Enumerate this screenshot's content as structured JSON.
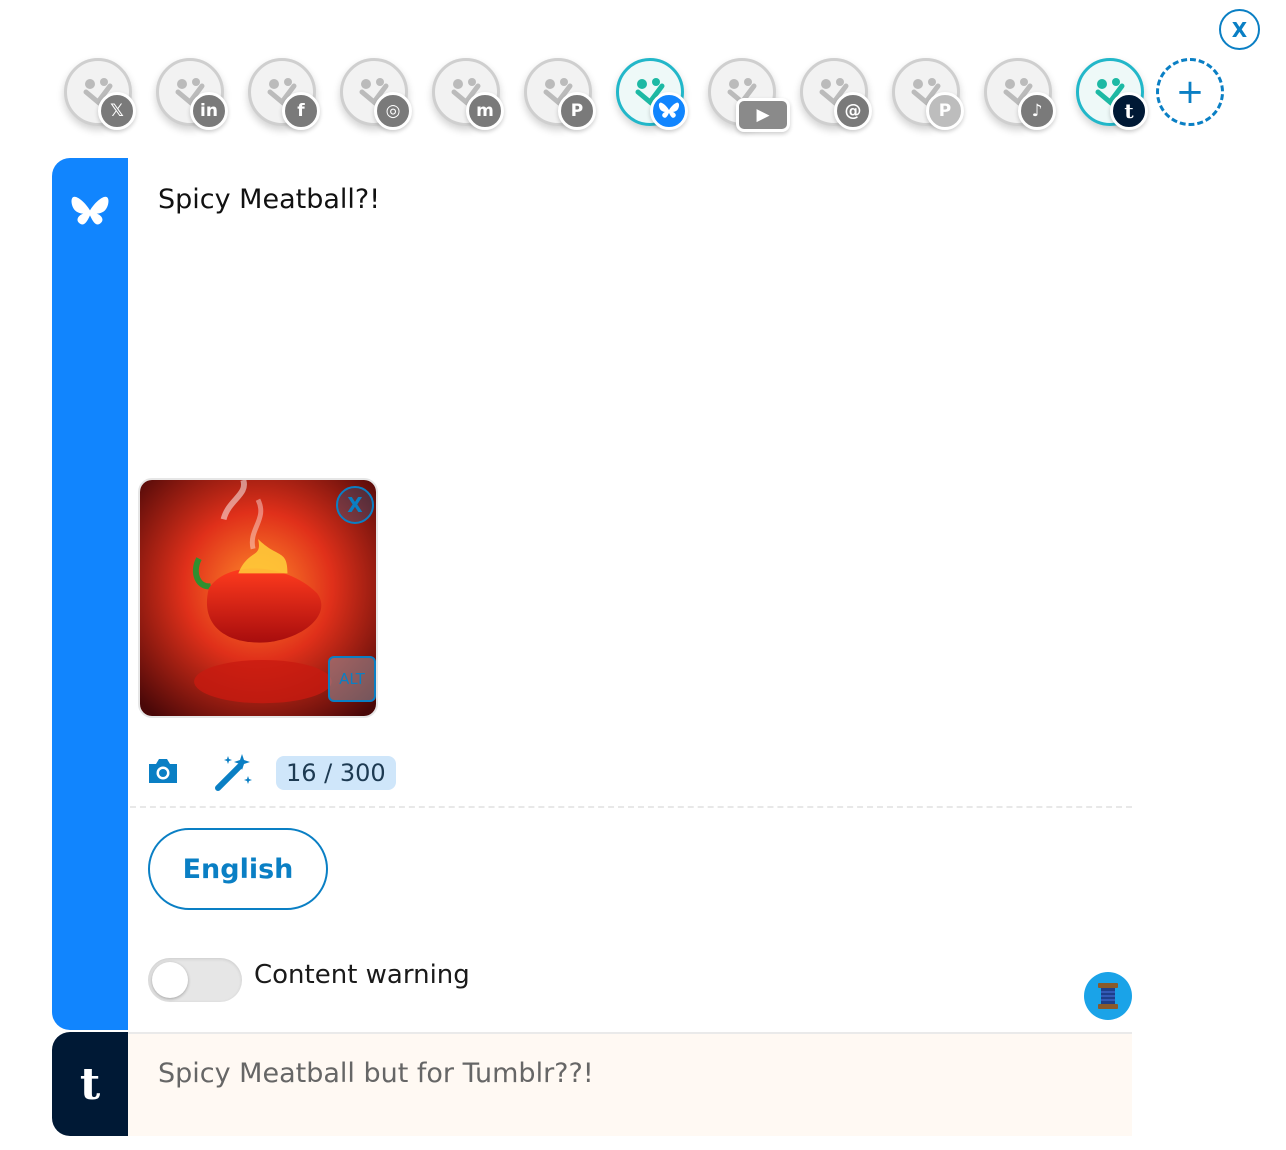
{
  "dialog": {
    "close_label": "X"
  },
  "accounts": [
    {
      "network": "X",
      "badge": "𝕏",
      "active": false
    },
    {
      "network": "LinkedIn",
      "badge": "in",
      "active": false
    },
    {
      "network": "Facebook",
      "badge": "f",
      "active": false
    },
    {
      "network": "Instagram",
      "badge": "◎",
      "active": false
    },
    {
      "network": "Mastodon",
      "badge": "m",
      "active": false
    },
    {
      "network": "Pinterest",
      "badge": "P",
      "active": false
    },
    {
      "network": "Bluesky",
      "badge": "",
      "active": true
    },
    {
      "network": "YouTube",
      "badge": "▶",
      "active": false
    },
    {
      "network": "Threads",
      "badge": "@",
      "active": false
    },
    {
      "network": "Pixelfed",
      "badge": "P",
      "active": false
    },
    {
      "network": "TikTok",
      "badge": "♪",
      "active": false
    },
    {
      "network": "Tumblr",
      "badge": "t",
      "active": true
    }
  ],
  "add_account_label": "+",
  "bluesky": {
    "post_text": "Spicy Meatball?!",
    "image_remove_label": "X",
    "image_alt_label": "ALT",
    "char_counter": "16 / 300",
    "language": "English",
    "content_warning_label": "Content warning",
    "content_warning_on": false
  },
  "tumblr": {
    "stripe_letter": "t",
    "post_text": "Spicy Meatball but for Tumblr??!"
  },
  "colors": {
    "bluesky": "#1185fe",
    "tumblr": "#001935",
    "accent": "#0a7fc4",
    "active_ring": "#22b7c9"
  }
}
